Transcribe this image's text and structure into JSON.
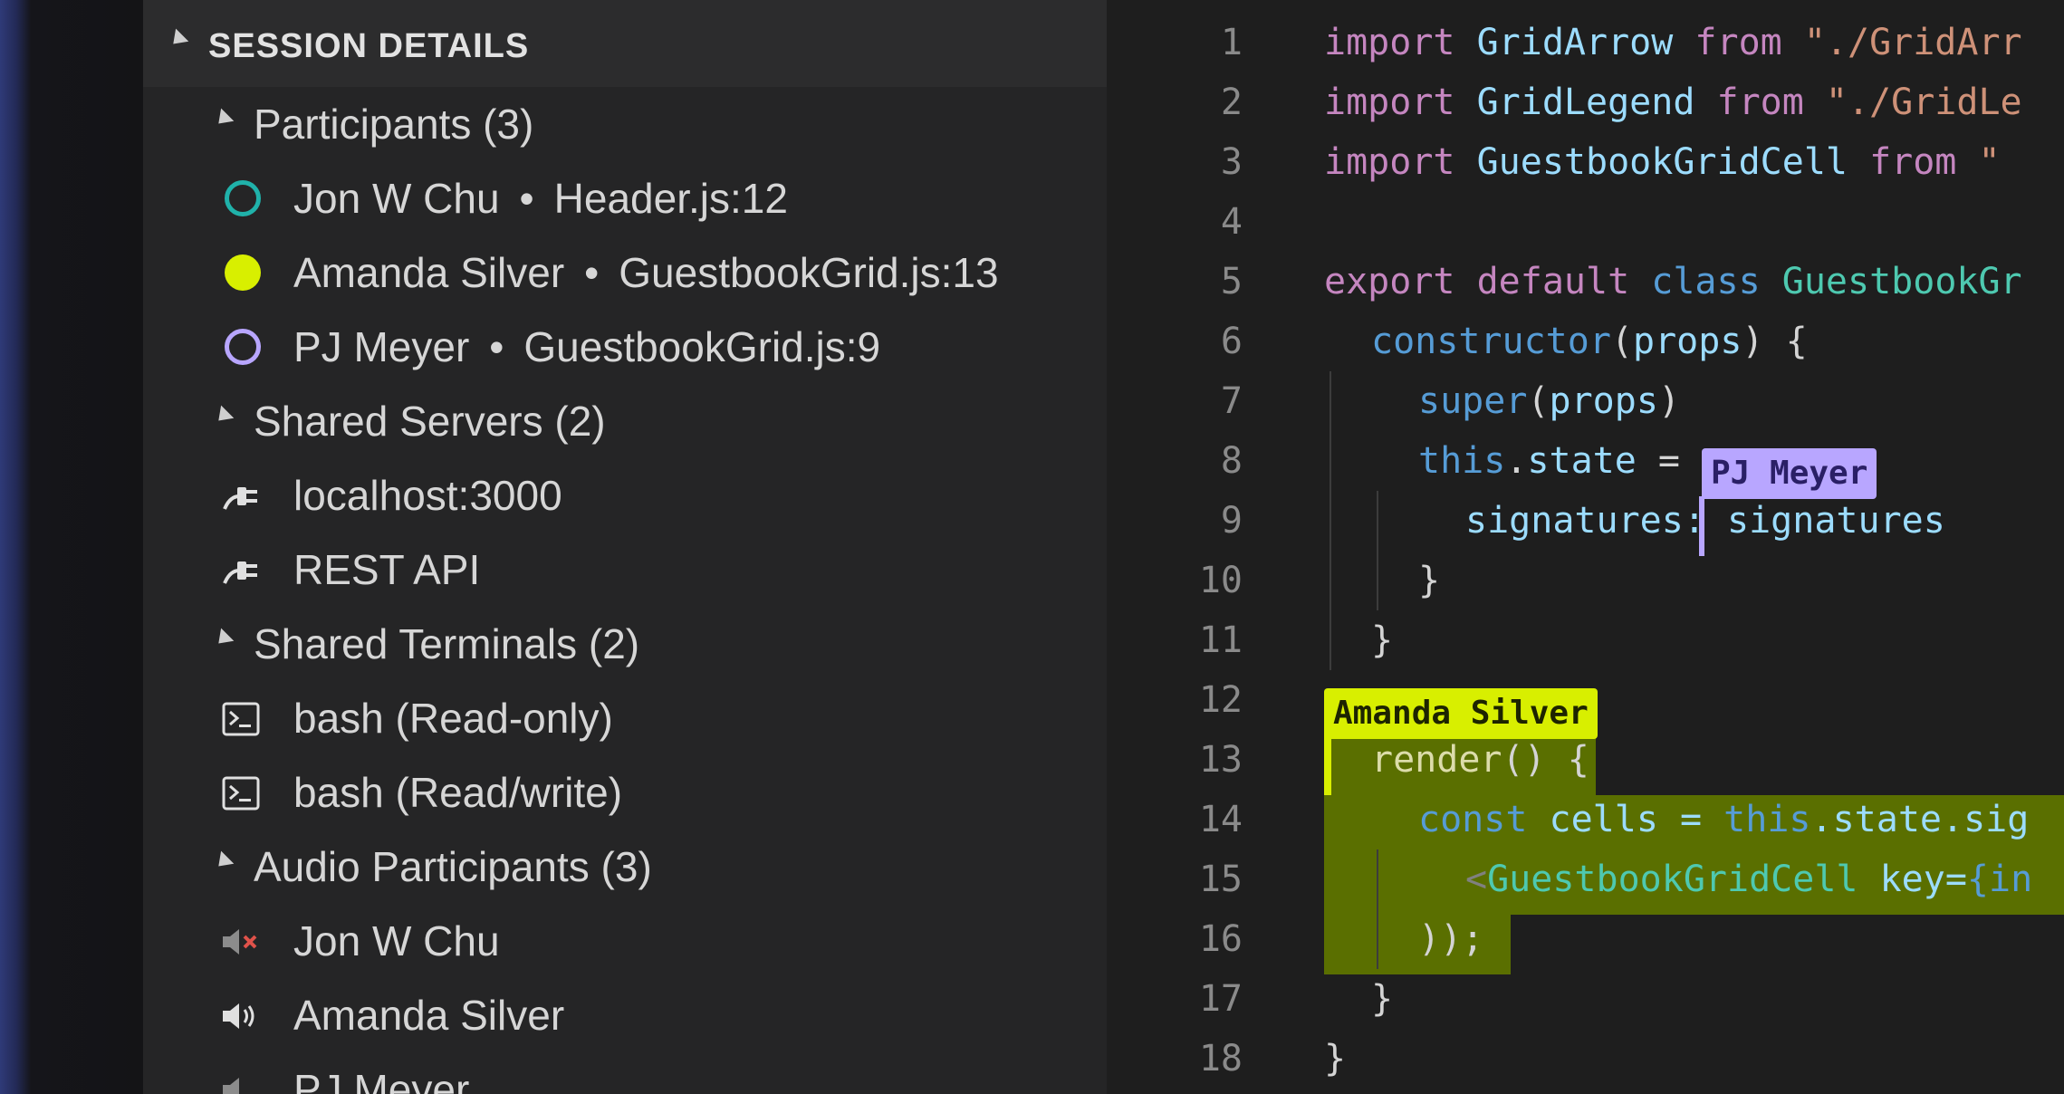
{
  "sidebar": {
    "header": "SESSION DETAILS",
    "groups": [
      {
        "label": "Participants (3)"
      },
      {
        "label": "Shared Servers (2)"
      },
      {
        "label": "Shared Terminals (2)"
      },
      {
        "label": "Audio Participants (3)"
      }
    ],
    "participants": [
      {
        "name": "Jon W Chu",
        "sep": "•",
        "location": "Header.js:12",
        "color": "#20b2aa",
        "style": "ring"
      },
      {
        "name": "Amanda Silver",
        "sep": "•",
        "location": "GuestbookGrid.js:13",
        "color": "#d8ef00",
        "style": "filled"
      },
      {
        "name": "PJ Meyer",
        "sep": "•",
        "location": "GuestbookGrid.js:9",
        "color": "#b8a6ff",
        "style": "ring"
      }
    ],
    "servers": [
      {
        "label": "localhost:3000",
        "icon": "plug-icon"
      },
      {
        "label": "REST API",
        "icon": "plug-icon"
      }
    ],
    "terminals": [
      {
        "label": "bash (Read-only)",
        "icon": "terminal-icon"
      },
      {
        "label": "bash (Read/write)",
        "icon": "terminal-icon"
      }
    ],
    "audio": [
      {
        "label": "Jon W Chu",
        "icon": "speaker-muted-icon"
      },
      {
        "label": "Amanda Silver",
        "icon": "speaker-on-icon"
      },
      {
        "label": "PJ Meyer",
        "icon": "speaker-icon"
      }
    ]
  },
  "editor": {
    "line_numbers": [
      "1",
      "2",
      "3",
      "4",
      "5",
      "6",
      "7",
      "8",
      "9",
      "10",
      "11",
      "12",
      "13",
      "14",
      "15",
      "16",
      "17",
      "18"
    ],
    "lines": {
      "l1": {
        "a": "import",
        "b": " GridArrow ",
        "c": "from",
        "d": " \"./GridArr"
      },
      "l2": {
        "a": "import",
        "b": " GridLegend ",
        "c": "from",
        "d": " \"./GridLe"
      },
      "l3": {
        "a": "import",
        "b": " GuestbookGridCell ",
        "c": "from",
        "d": " \""
      },
      "l5": {
        "a": "export",
        "b": " default",
        "c": " class",
        "d": " GuestbookGr"
      },
      "l6": {
        "a": "constructor",
        "b": "(",
        "c": "props",
        "d": ") {"
      },
      "l7": {
        "a": "super",
        "b": "(",
        "c": "props",
        "d": ")"
      },
      "l8": {
        "a": "this",
        "b": ".",
        "c": "state",
        "d": " ="
      },
      "l9": {
        "a": "signatures",
        "b": ": signatures"
      },
      "l10": {
        "a": "}"
      },
      "l11": {
        "a": "}"
      },
      "l13": {
        "a": "render",
        "b": "() {"
      },
      "l14": {
        "a": "const",
        "b": " cells = ",
        "c": "this",
        "d": ".state.sig"
      },
      "l15": {
        "a": "<",
        "b": "GuestbookGridCell",
        "c": " key=",
        "d": "{in"
      },
      "l16": {
        "a": "));"
      },
      "l17": {
        "a": "}"
      },
      "l18": {
        "a": "}"
      }
    },
    "flags": {
      "pj": "PJ Meyer",
      "amanda": "Amanda Silver"
    },
    "colors": {
      "amanda": "#d8ef00",
      "pj": "#b8a6ff",
      "jon": "#20b2aa"
    }
  }
}
